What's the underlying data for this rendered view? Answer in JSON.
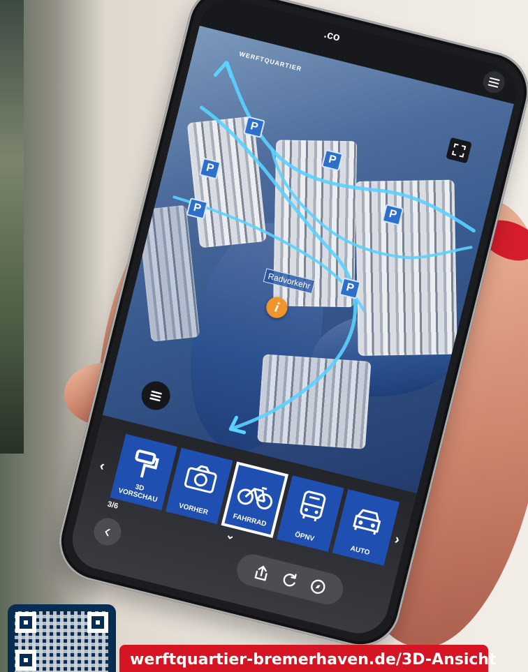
{
  "browser": {
    "url_partial": ".co",
    "menu_icon": "menu-icon"
  },
  "map": {
    "brand": "WERFTQUARTIER",
    "label": "Radvorkehr",
    "info_symbol": "i",
    "parking_label": "P",
    "route_color": "#5bd2ff",
    "water_color": "#2f5290",
    "accent_color": "#f0942d"
  },
  "modes": {
    "counter": "3/6",
    "items": [
      {
        "label": "3D VORSCHAU",
        "icon": "paint-roller-icon"
      },
      {
        "label": "VORHER",
        "icon": "camera-icon"
      },
      {
        "label": "FAHRRAD",
        "icon": "bicycle-icon"
      },
      {
        "label": "ÖPNV",
        "icon": "bus-icon"
      },
      {
        "label": "AUTO",
        "icon": "car-icon"
      }
    ],
    "selected": "FAHRRAD",
    "left_arrow": "‹",
    "right_arrow": "›",
    "down_arrow": "⌄"
  },
  "controls": {
    "back": "‹",
    "share_icon": "share-icon",
    "refresh_icon": "refresh-icon",
    "compass_icon": "compass-icon"
  },
  "promo": {
    "url": "werftquartier-bremerhaven.de/3D-Ansicht",
    "qr_color": "#072d53",
    "banner_color": "#d51424"
  }
}
